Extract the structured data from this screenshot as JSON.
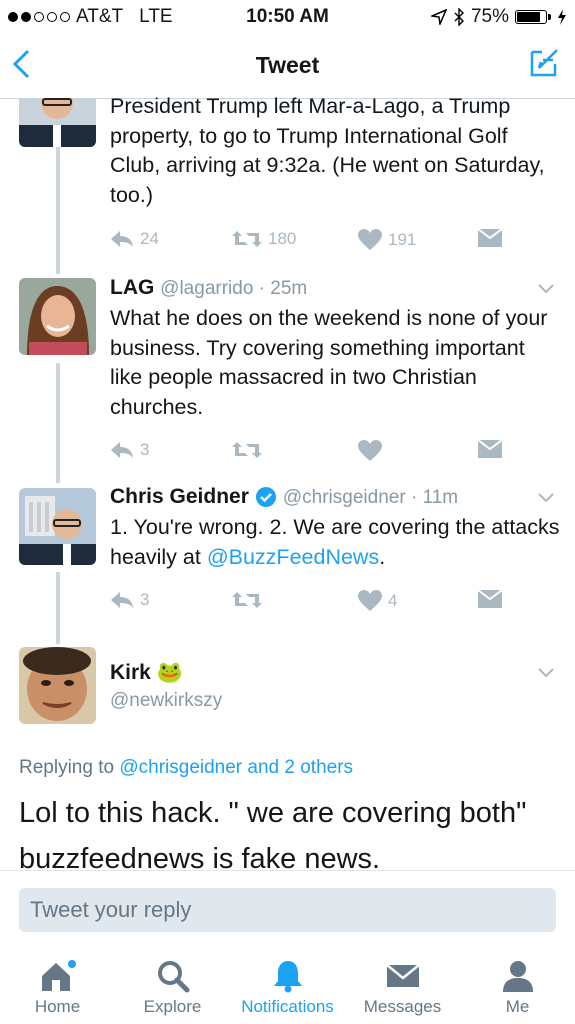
{
  "status_bar": {
    "carrier": "AT&T",
    "network": "LTE",
    "time": "10:50 AM",
    "battery": "75%"
  },
  "nav": {
    "title": "Tweet"
  },
  "tweets": [
    {
      "text": "President Trump left Mar-a-Lago, a Trump property, to go to Trump International Golf Club, arriving at 9:32a. (He went on Saturday, too.)",
      "replies": "24",
      "retweets": "180",
      "likes": "191"
    },
    {
      "name": "LAG",
      "handle": "@lagarrido",
      "time": "25m",
      "text": "What he does on the weekend is none of your business. Try covering something important like people massacred in two Christian churches.",
      "replies": "3",
      "retweets": "",
      "likes": ""
    },
    {
      "name": "Chris Geidner",
      "handle": "@chrisgeidner",
      "time": "11m",
      "text": "1. You're wrong. 2. We are covering the attacks heavily at ",
      "link": "@BuzzFeedNews",
      "text_end": ".",
      "replies": "3",
      "retweets": "",
      "likes": "4"
    }
  ],
  "main_tweet": {
    "name": "Kirk",
    "emoji": "🐸",
    "handle": "@newkirkszy",
    "replying_prefix": "Replying to ",
    "replying_targets": "@chrisgeidner and 2 others",
    "text": "Lol to this hack. \" we are covering both\" buzzfeednews is fake news."
  },
  "reply_box": {
    "placeholder": "Tweet your reply"
  },
  "tabs": [
    {
      "label": "Home",
      "icon": "home-icon"
    },
    {
      "label": "Explore",
      "icon": "search-icon"
    },
    {
      "label": "Notifications",
      "icon": "bell-icon",
      "active": true
    },
    {
      "label": "Messages",
      "icon": "envelope-icon"
    },
    {
      "label": "Me",
      "icon": "person-icon"
    }
  ],
  "colors": {
    "accent": "#1da1f2",
    "icon_gray": "#aab8c2",
    "text_gray": "#657786",
    "tab_gray": "#657786"
  }
}
